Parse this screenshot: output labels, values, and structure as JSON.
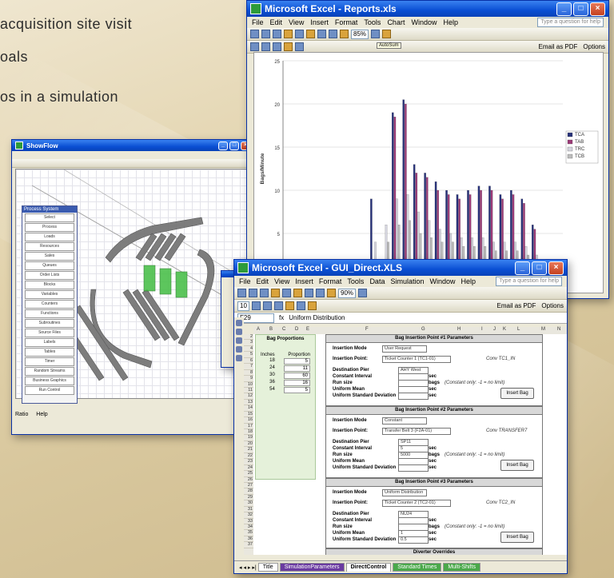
{
  "slide": {
    "bullet1": "acquisition site visit",
    "bullet2": "oals",
    "bullet3": "os in a simulation"
  },
  "reports": {
    "title": "Microsoft Excel - Reports.xls",
    "menu": [
      "File",
      "Edit",
      "View",
      "Insert",
      "Format",
      "Tools",
      "Chart",
      "Window",
      "Help"
    ],
    "help_placeholder": "Type a question for help",
    "zoom": "85%",
    "email_pdf": "Email as PDF",
    "options": "Options",
    "tooltip": "AutoSum"
  },
  "chart_data": {
    "type": "bar",
    "ylabel": "Bags/Minute",
    "ylim": [
      0,
      25
    ],
    "yticks": [
      0,
      5,
      10,
      15,
      20,
      25
    ],
    "legend_position": "right",
    "series": [
      {
        "name": "TCA",
        "color": "#27317a",
        "values": [
          0,
          0,
          0,
          0,
          0,
          0,
          0,
          0.3,
          9,
          0,
          19,
          20.5,
          13,
          12,
          11,
          10,
          9.5,
          10,
          10.5,
          10.5,
          9.5,
          10,
          9,
          6,
          2,
          0
        ]
      },
      {
        "name": "TAB",
        "color": "#9c3a78",
        "values": [
          0,
          0,
          0,
          0,
          0,
          0,
          0,
          0.2,
          0,
          0,
          18.5,
          20,
          12,
          11.5,
          10,
          9.5,
          9,
          9.5,
          10,
          10,
          9,
          9.5,
          8.5,
          5.5,
          1.5,
          0
        ]
      },
      {
        "name": "TRC",
        "color": "#d5d5df",
        "values": [
          0,
          0,
          0,
          0,
          0,
          0,
          0,
          0.1,
          4,
          6,
          9,
          9.5,
          7.5,
          6.5,
          5.5,
          5,
          4.5,
          4.5,
          4.5,
          4,
          4,
          4,
          3.5,
          2.5,
          1,
          0
        ]
      },
      {
        "name": "TCB",
        "color": "#bdbdbd",
        "values": [
          0,
          0,
          0,
          0,
          0,
          0,
          0,
          0.1,
          2,
          4,
          6,
          6.5,
          5,
          4.5,
          4,
          4,
          3.5,
          3.5,
          3.5,
          3,
          3,
          3,
          2.5,
          2,
          0.5,
          0
        ]
      }
    ]
  },
  "sim": {
    "title": "ShowFlow",
    "palette_title": "Process System",
    "palette_items": [
      "Select",
      "Process",
      "Loads",
      "Resources",
      "Sales",
      "Queues",
      "Order Lists",
      "Blocks",
      "Variables",
      "Counters",
      "Functions",
      "Subroutines",
      "Source Files",
      "Labels",
      "Tables",
      "Timer",
      "Random Streams",
      "Business Graphics",
      "Run Control"
    ],
    "status_left": "Ratio",
    "status_right": "Help"
  },
  "gui": {
    "title": "Microsoft Excel - GUI_Direct.XLS",
    "menu": [
      "File",
      "Edit",
      "View",
      "Insert",
      "Format",
      "Tools",
      "Data",
      "Simulation",
      "Window",
      "Help"
    ],
    "help_placeholder": "Type a question for help",
    "zoom": "90%",
    "font_size": "10",
    "email_pdf": "Email as PDF",
    "options": "Options",
    "namebox": "F29",
    "formula": "Uniform Distribution",
    "columns": [
      "A",
      "B",
      "C",
      "D",
      "E",
      "F",
      "G",
      "H",
      "I",
      "J",
      "K",
      "L",
      "M",
      "N"
    ],
    "rows": [
      "2",
      "3",
      "4",
      "5",
      "6",
      "7",
      "8",
      "9",
      "10",
      "11",
      "12",
      "13",
      "14",
      "15",
      "16",
      "17",
      "18",
      "19",
      "20",
      "21",
      "22",
      "23",
      "24",
      "25",
      "26",
      "27",
      "28",
      "29",
      "30",
      "31",
      "32",
      "33",
      "34",
      "35",
      "36",
      "37"
    ],
    "proportions": {
      "title": "Bag Proportions",
      "col1": "Inches",
      "col2": "Proportion",
      "rows": [
        [
          "18",
          "5"
        ],
        [
          "24",
          "11"
        ],
        [
          "30",
          "60"
        ],
        [
          "36",
          "16"
        ],
        [
          "54",
          "5"
        ]
      ]
    },
    "panels": [
      {
        "title": "Bag Insertion Point #1 Parameters",
        "mode": "User Request",
        "point": "Ticket Counter 1 (TC1-01)",
        "conv": "Conv TC1_IN",
        "pier": "AHY West",
        "interval": "",
        "runsize": "",
        "mean": "",
        "sd": "",
        "note": "(Constant only: -1 = no limit)"
      },
      {
        "title": "Bag Insertion Point #2 Parameters",
        "mode": "Constant",
        "point": "Transfer Belt 3 (F2A-01)",
        "conv": "Conv TRANSFER7",
        "pier": "SP11",
        "interval": "5",
        "runsize": "5000",
        "mean": "",
        "sd": "",
        "note": "(Constant only: -1 = no limit)"
      },
      {
        "title": "Bag Insertion Point #3 Parameters",
        "mode": "Uniform Distribution",
        "point": "Ticket Counter 2 (TC2-01)",
        "conv": "Conv TC2_IN",
        "pier": "NU24",
        "interval": "",
        "runsize": "",
        "mean": "1",
        "sd": "0.5",
        "note": "(Constant only: -1 = no limit)"
      }
    ],
    "labels": {
      "mode": "Insertion Mode",
      "point": "Insertion Point:",
      "pier": "Destination Pier",
      "interval": "Constant Interval",
      "runsize": "Run size",
      "mean": "Uniform Mean",
      "sd": "Uniform Standard Deviation",
      "unit_sec": "sec",
      "unit_bags": "bags",
      "insert_btn": "Insert Bag"
    },
    "diverter": "Diverter Overrides",
    "tabs": [
      "Title",
      "SimulationParameters",
      "DirectControl",
      "Standard Times",
      "Multi-Shifts"
    ]
  }
}
